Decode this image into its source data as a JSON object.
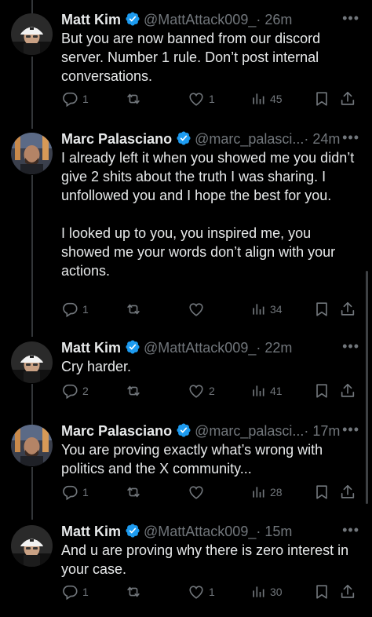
{
  "colors": {
    "background": "#000000",
    "text": "#e7e9ea",
    "muted": "#71767b",
    "verified": "#1d9bf0",
    "line": "#333639"
  },
  "tweets": [
    {
      "name": "Matt Kim",
      "handle": "@MattAttack009_",
      "time": "· 26m",
      "text": "But you are now banned from our discord server. Number 1 rule. Don’t post internal conversations.",
      "replies": "1",
      "reposts": "",
      "likes": "1",
      "views": "45"
    },
    {
      "name": "Marc Palasciano",
      "handle": "@marc_palasci...",
      "time": "· 24m",
      "text": "I already left it when you showed me you didn’t give 2 shits about the truth I was sharing. I unfollowed you and I hope the best for you.\n\nI looked up to you, you inspired me, you showed me your words don’t align with your actions.",
      "replies": "1",
      "reposts": "",
      "likes": "",
      "views": "34"
    },
    {
      "name": "Matt Kim",
      "handle": "@MattAttack009_",
      "time": "· 22m",
      "text": "Cry harder.",
      "replies": "2",
      "reposts": "",
      "likes": "2",
      "views": "41"
    },
    {
      "name": "Marc Palasciano",
      "handle": "@marc_palasci...",
      "time": "· 17m",
      "text": "You are proving exactly what’s wrong with politics and the X community...",
      "replies": "1",
      "reposts": "",
      "likes": "",
      "views": "28"
    },
    {
      "name": "Matt Kim",
      "handle": "@MattAttack009_",
      "time": "· 15m",
      "text": "And u are proving why there is zero interest in your case.",
      "replies": "1",
      "reposts": "",
      "likes": "1",
      "views": "30"
    }
  ],
  "icons": {
    "more": "more-icon",
    "reply": "reply-icon",
    "repost": "repost-icon",
    "like": "like-icon",
    "views": "views-icon",
    "bookmark": "bookmark-icon",
    "share": "share-icon"
  },
  "more_glyph": "•••"
}
